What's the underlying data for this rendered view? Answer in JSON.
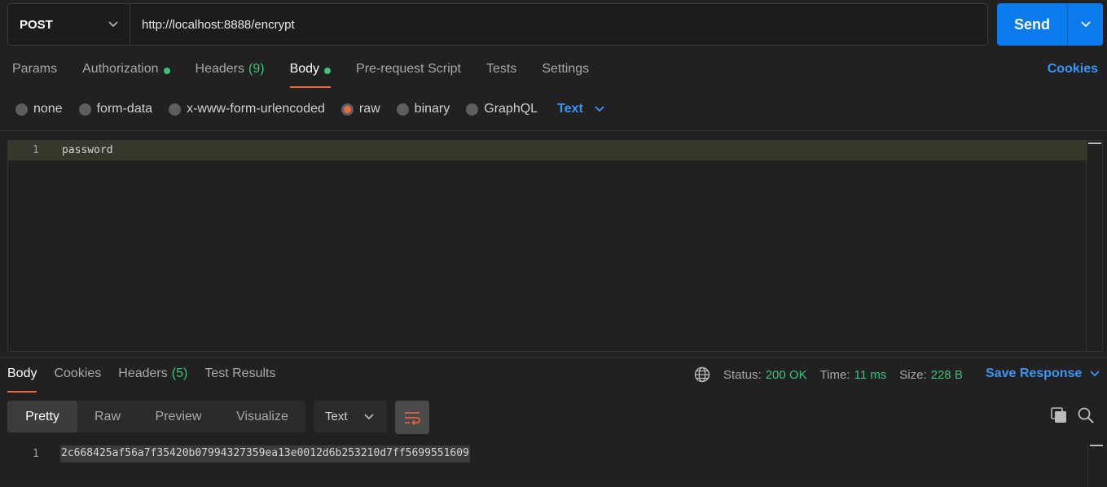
{
  "request": {
    "method": "POST",
    "url": "http://localhost:8888/encrypt",
    "send_label": "Send"
  },
  "request_tabs": [
    {
      "label": "Params"
    },
    {
      "label": "Authorization",
      "dot": true
    },
    {
      "label": "Headers",
      "count": "(9)"
    },
    {
      "label": "Body",
      "dot": true,
      "active": true
    },
    {
      "label": "Pre-request Script"
    },
    {
      "label": "Tests"
    },
    {
      "label": "Settings"
    }
  ],
  "cookies_label": "Cookies",
  "body_types": [
    "none",
    "form-data",
    "x-www-form-urlencoded",
    "raw",
    "binary",
    "GraphQL"
  ],
  "selected_body_type": "raw",
  "body_format": "Text",
  "editor": {
    "line_number": "1",
    "content": "password"
  },
  "response_tabs": [
    {
      "label": "Body",
      "active": true
    },
    {
      "label": "Cookies"
    },
    {
      "label": "Headers",
      "count": "(5)"
    },
    {
      "label": "Test Results"
    }
  ],
  "response_status": {
    "status_label": "Status:",
    "status_value": "200 OK",
    "time_label": "Time:",
    "time_value": "11 ms",
    "size_label": "Size:",
    "size_value": "228 B"
  },
  "save_response_label": "Save Response",
  "view_modes": [
    "Pretty",
    "Raw",
    "Preview",
    "Visualize"
  ],
  "active_view_mode": "Pretty",
  "response_format": "Text",
  "response_body": {
    "line_number": "1",
    "content": "2c668425af56a7f35420b07994327359ea13e0012d6b253210d7ff5699551609"
  },
  "colors": {
    "accent_blue": "#097bed",
    "active_orange": "#ef6b3c",
    "success_green": "#3bc37a"
  }
}
